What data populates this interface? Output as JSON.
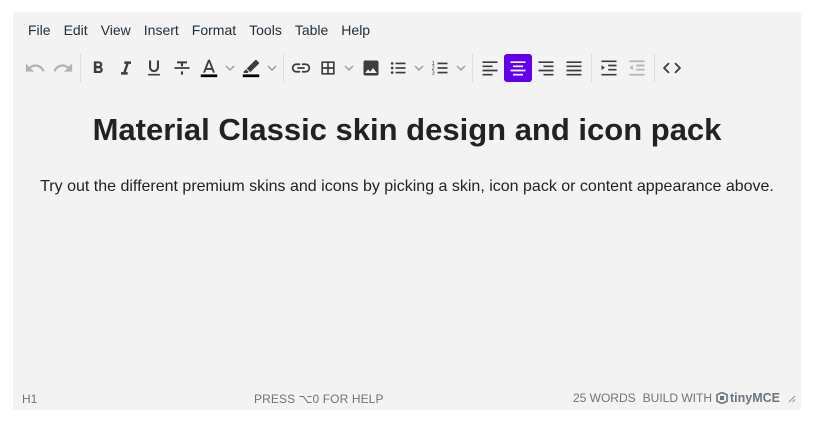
{
  "menubar": {
    "items": [
      "File",
      "Edit",
      "View",
      "Insert",
      "Format",
      "Tools",
      "Table",
      "Help"
    ]
  },
  "toolbar": {
    "icons": [
      "undo-icon",
      "redo-icon",
      "bold-icon",
      "italic-icon",
      "underline-icon",
      "strikethrough-icon",
      "text-color-icon",
      "highlight-color-icon",
      "link-icon",
      "table-icon",
      "image-icon",
      "bullet-list-icon",
      "numbered-list-icon",
      "align-left-icon",
      "align-center-icon",
      "align-right-icon",
      "align-justify-icon",
      "indent-icon",
      "outdent-icon",
      "source-code-icon"
    ],
    "active": "align-center",
    "accent_color": "#6200ee",
    "text_color_swatch": "#000000",
    "highlight_swatch": "#000000"
  },
  "content": {
    "heading": "Material Classic skin design and icon pack",
    "paragraph": "Try out the different premium skins and icons by picking a skin, icon pack or content appearance above."
  },
  "statusbar": {
    "path": "H1",
    "help": "PRESS ⌥0 FOR HELP",
    "words": "25 WORDS",
    "build": "BUILD WITH",
    "brand": "tinyMCE"
  }
}
